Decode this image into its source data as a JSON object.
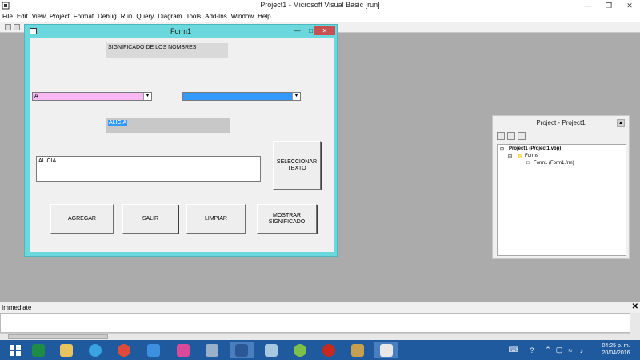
{
  "ide": {
    "title": "Project1 - Microsoft Visual Basic [run]",
    "menu": [
      "File",
      "Edit",
      "View",
      "Project",
      "Format",
      "Debug",
      "Run",
      "Query",
      "Diagram",
      "Tools",
      "Add-Ins",
      "Window",
      "Help"
    ]
  },
  "form1": {
    "title": "Form1",
    "label_significado": "SIGNIFICADO DE LOS NOMBRES",
    "combo1_value": "A",
    "combo2_value": "",
    "label_name": "ALICIA",
    "textbox_value": "ALICIA",
    "buttons": {
      "seleccionar": "SELECCIONAR TEXTO",
      "agregar": "AGREGAR",
      "salir": "SALIR",
      "limpiar": "LIMPIAR",
      "mostrar": "MOSTRAR SIGNIFICADO"
    },
    "colors": {
      "combo1_bg": "#f9b7f3",
      "combo2_bg": "#3399ff",
      "titlebar": "#6ad8dc"
    }
  },
  "project_panel": {
    "title": "Project - Project1",
    "tree": {
      "project": "Project1 (Project1.vbp)",
      "folder": "Forms",
      "form": "Form1 (Form1.frm)"
    }
  },
  "immediate": {
    "title": "Immediate"
  },
  "taskbar": {
    "clock_time": "04:25 p. m.",
    "clock_date": "20/04/2016",
    "apps": [
      "start-icon",
      "excel-icon",
      "file-explorer-icon",
      "internet-explorer-icon",
      "chrome-icon",
      "dropbox-icon",
      "app-icon",
      "network-icon",
      "word-icon",
      "notepad-icon",
      "cortona-icon",
      "flash-icon",
      "tools-icon",
      "vb6-icon"
    ]
  }
}
